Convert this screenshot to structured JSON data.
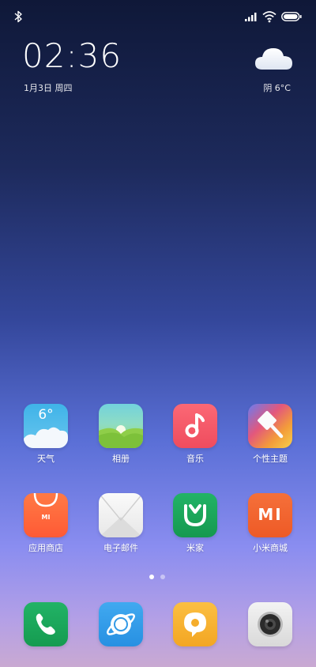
{
  "status_bar": {
    "icons": [
      "bluetooth-icon",
      "signal-icon",
      "wifi-icon",
      "battery-icon"
    ]
  },
  "clock": {
    "time": "02:36",
    "date": "1月3日 周四"
  },
  "weather_widget": {
    "icon": "cloud-icon",
    "text": "阴 6°C"
  },
  "icon_weather_temp": "6°",
  "icon_mi_text": "MI",
  "apps": [
    {
      "label": "天气",
      "icon": "weather-app-icon",
      "color": "#4fb9e6"
    },
    {
      "label": "相册",
      "icon": "gallery-app-icon",
      "color": "#7fd0a7"
    },
    {
      "label": "音乐",
      "icon": "music-app-icon",
      "color": "#f25b6a"
    },
    {
      "label": "个性主题",
      "icon": "themes-app-icon",
      "color": "#f0a040"
    },
    {
      "label": "应用商店",
      "icon": "app-store-icon",
      "color": "#ff6a3d"
    },
    {
      "label": "电子邮件",
      "icon": "email-app-icon",
      "color": "#eeeeee"
    },
    {
      "label": "米家",
      "icon": "mijia-app-icon",
      "color": "#1faa5a"
    },
    {
      "label": "小米商城",
      "icon": "mi-store-app-icon",
      "color": "#f26530"
    }
  ],
  "dock": [
    {
      "icon": "phone-app-icon",
      "color": "#1faa5a"
    },
    {
      "icon": "browser-app-icon",
      "color": "#3aa0ea"
    },
    {
      "icon": "messages-app-icon",
      "color": "#f7b333"
    },
    {
      "icon": "camera-app-icon",
      "color": "#e6e6e6"
    }
  ],
  "page_indicator": {
    "pages": 2,
    "current": 1
  }
}
